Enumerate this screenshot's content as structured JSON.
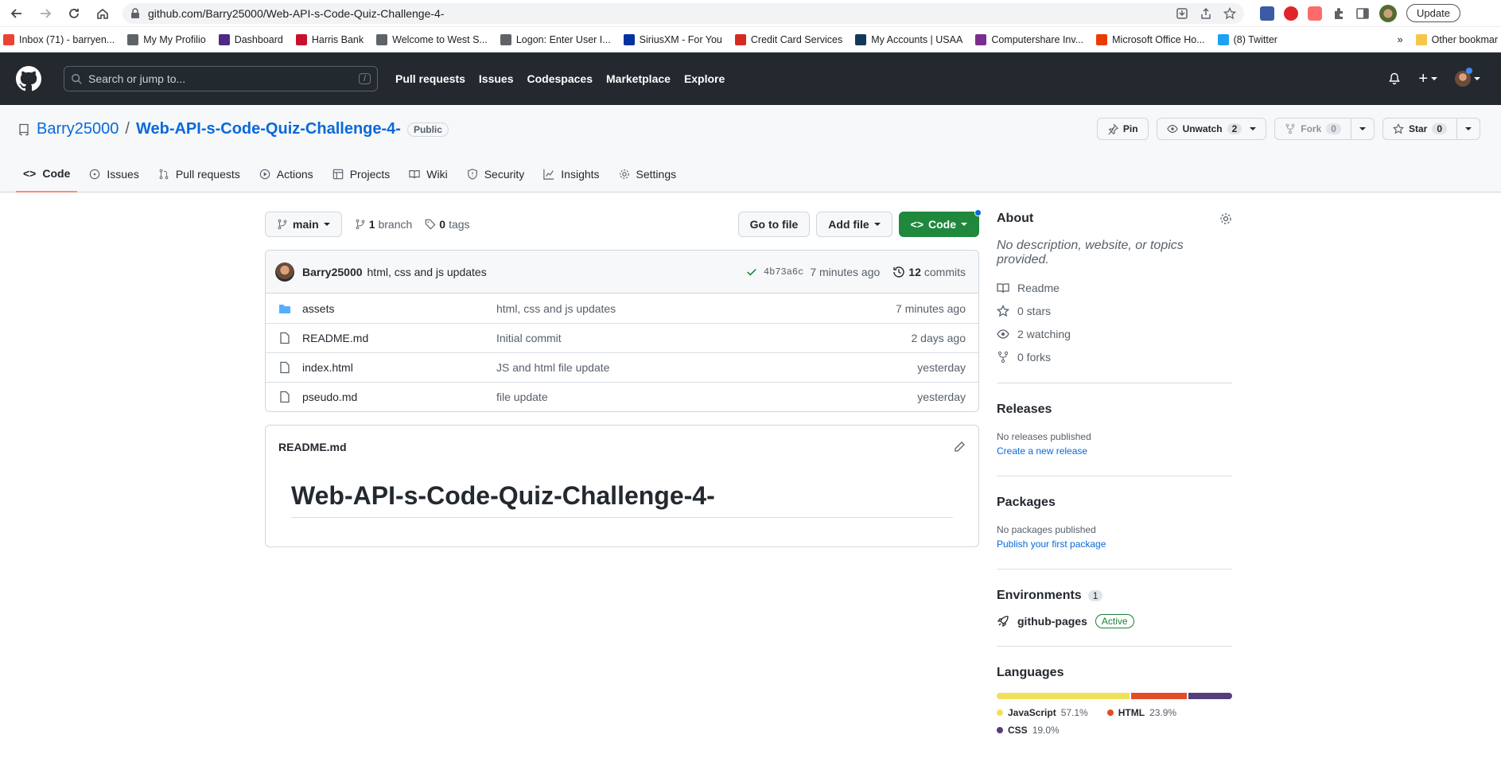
{
  "browser": {
    "url": "github.com/Barry25000/Web-API-s-Code-Quiz-Challenge-4-",
    "update_label": "Update",
    "bookmarks": [
      {
        "label": "Inbox (71) - barryen...",
        "color": "#ea4335"
      },
      {
        "label": "My My Profilio",
        "color": "#5f6368"
      },
      {
        "label": "Dashboard",
        "color": "#4e2a84"
      },
      {
        "label": "Harris Bank",
        "color": "#c8102e"
      },
      {
        "label": "Welcome to West S...",
        "color": "#5f6368"
      },
      {
        "label": "Logon: Enter User I...",
        "color": "#5f6368"
      },
      {
        "label": "SiriusXM - For You",
        "color": "#0033a0"
      },
      {
        "label": "Credit Card Services",
        "color": "#d52b1e"
      },
      {
        "label": "My Accounts | USAA",
        "color": "#12395b"
      },
      {
        "label": "Computershare Inv...",
        "color": "#7b2d8e"
      },
      {
        "label": "Microsoft Office Ho...",
        "color": "#eb3c00"
      },
      {
        "label": "(8) Twitter",
        "color": "#1da1f2"
      }
    ],
    "more": "»",
    "other_bookmarks": "Other bookmar"
  },
  "gh": {
    "search_placeholder": "Search or jump to...",
    "slash": "/",
    "nav": [
      "Pull requests",
      "Issues",
      "Codespaces",
      "Marketplace",
      "Explore"
    ],
    "plus": "+"
  },
  "repo": {
    "owner": "Barry25000",
    "sep": "/",
    "name": "Web-API-s-Code-Quiz-Challenge-4-",
    "visibility": "Public",
    "pin": "Pin",
    "unwatch": "Unwatch",
    "watch_count": "2",
    "fork": "Fork",
    "fork_count": "0",
    "star": "Star",
    "star_count": "0",
    "tabs": [
      "Code",
      "Issues",
      "Pull requests",
      "Actions",
      "Projects",
      "Wiki",
      "Security",
      "Insights",
      "Settings"
    ]
  },
  "toolbar": {
    "branch": "main",
    "branch_count": "1",
    "branch_word": "branch",
    "tag_count": "0",
    "tag_word": "tags",
    "go_to_file": "Go to file",
    "add_file": "Add file",
    "code": "Code"
  },
  "commit": {
    "author": "Barry25000",
    "message": "html, css and js updates",
    "sha": "4b73a6c",
    "time": "7 minutes ago",
    "count": "12",
    "count_word": "commits"
  },
  "files": [
    {
      "name": "assets",
      "type": "dir",
      "message": "html, css and js updates",
      "date": "7 minutes ago"
    },
    {
      "name": "README.md",
      "type": "file",
      "message": "Initial commit",
      "date": "2 days ago"
    },
    {
      "name": "index.html",
      "type": "file",
      "message": "JS and html file update",
      "date": "yesterday"
    },
    {
      "name": "pseudo.md",
      "type": "file",
      "message": "file update",
      "date": "yesterday"
    }
  ],
  "readme": {
    "filename": "README.md",
    "heading": "Web-API-s-Code-Quiz-Challenge-4-"
  },
  "about": {
    "title": "About",
    "description": "No description, website, or topics provided.",
    "readme": "Readme",
    "stars": "0 stars",
    "watching": "2 watching",
    "forks": "0 forks"
  },
  "releases": {
    "title": "Releases",
    "empty": "No releases published",
    "link": "Create a new release"
  },
  "packages": {
    "title": "Packages",
    "empty": "No packages published",
    "link": "Publish your first package"
  },
  "environments": {
    "title": "Environments",
    "count": "1",
    "name": "github-pages",
    "status": "Active"
  },
  "languages": {
    "title": "Languages",
    "items": [
      {
        "name": "JavaScript",
        "pct": "57.1%",
        "value": 57.1,
        "color": "#f1e05a"
      },
      {
        "name": "HTML",
        "pct": "23.9%",
        "value": 23.9,
        "color": "#e34c26"
      },
      {
        "name": "CSS",
        "pct": "19.0%",
        "value": 19.0,
        "color": "#563d7c"
      }
    ]
  }
}
